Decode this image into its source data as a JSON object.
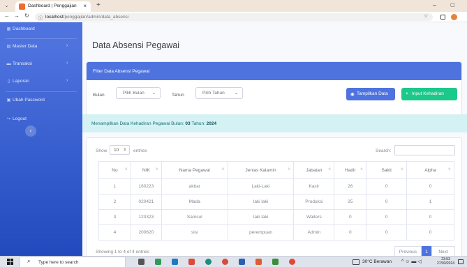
{
  "browser": {
    "tab_title": "Dashboard | Penggajian",
    "tab_close": "×",
    "new_tab": "+",
    "url_host": "localhost",
    "url_path": "/penggajian/admin/data_absensi",
    "minimize": "–",
    "maximize": "▢"
  },
  "sidebar": {
    "items": [
      {
        "label": "Dashboard",
        "icon": "dashboard-icon"
      },
      {
        "label": "Master Data",
        "icon": "database-icon",
        "caret": "›"
      },
      {
        "label": "Transaksi",
        "icon": "money-icon",
        "caret": "›"
      },
      {
        "label": "Laporan",
        "icon": "file-icon",
        "caret": "›"
      },
      {
        "label": "Ubah Password",
        "icon": "lock-icon"
      },
      {
        "label": "Logout",
        "icon": "logout-icon"
      }
    ],
    "toggle": "‹"
  },
  "main": {
    "page_title": "Data Absensi Pegawai",
    "filter": {
      "title": "Filter Data Absensi Pegawai",
      "bulan_label": "Bulan",
      "bulan_select": "Pilih Bulan",
      "tahun_label": "Tahun",
      "tahun_select": "Pilih Tahun",
      "show_button": "Tampilkan Data",
      "input_button": "Input Kehadiran"
    },
    "alert": {
      "prefix": "Menampilkan Data Kehadiran Pegawai Bulan: ",
      "bulan": "03",
      "mid": " Tahun: ",
      "tahun": "2024"
    },
    "table": {
      "show_label": "Show",
      "page_length": "10",
      "entries_label": "entries",
      "search_label": "Search:",
      "columns": [
        "No",
        "NIK",
        "Nama Pegawai",
        "Jenias Kalamin",
        "Jabatan",
        "Hadir",
        "Sakit",
        "Alpha"
      ],
      "rows": [
        [
          "1",
          "160223",
          "akbar",
          "Laki-Laki",
          "Kasir",
          "26",
          "0",
          "0"
        ],
        [
          "2",
          "020421",
          "Mada",
          "laki laki",
          "Produksi",
          "25",
          "0",
          "1"
        ],
        [
          "3",
          "120323",
          "Samsul",
          "laki laki",
          "Waiters",
          "0",
          "0",
          "0"
        ],
        [
          "4",
          "200620",
          "sisi",
          "perempuan",
          "Admin",
          "0",
          "0",
          "0"
        ]
      ],
      "info": "Showing 1 to 4 of 4 entries",
      "prev": "Previous",
      "current_page": "1",
      "next": "Next"
    }
  },
  "taskbar": {
    "search_placeholder": "Type here to search",
    "weather": "30°C  Berawan",
    "time": "23:53",
    "date": "27/03/2024"
  },
  "colors": {
    "primary": "#4e73df",
    "success": "#1cc88a",
    "alert_bg": "#d4f2f4"
  }
}
